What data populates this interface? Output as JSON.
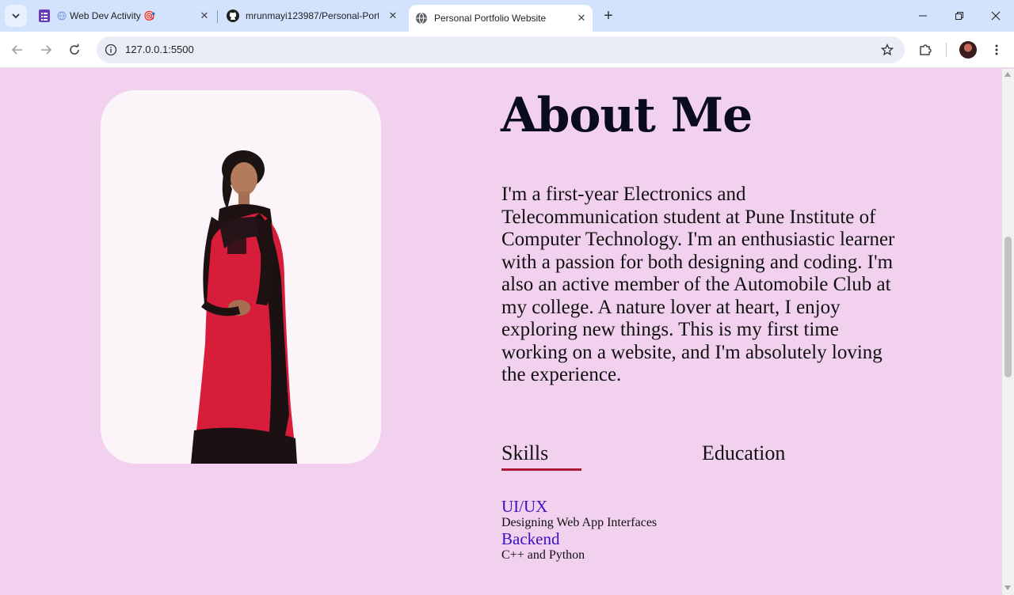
{
  "browser": {
    "tabs": [
      {
        "title": "Web Dev Activity 🎯",
        "icon": "forms-icon"
      },
      {
        "title": "mrunmayi123987/Personal-Port",
        "icon": "github-icon"
      },
      {
        "title": "Personal Portfolio Website",
        "icon": "globe-icon",
        "active": true
      }
    ],
    "url": "127.0.0.1:5500"
  },
  "about": {
    "title": "About Me",
    "text": "I'm a first-year Electronics and Telecommunication student at Pune Institute of Computer Technology. I'm an enthusiastic learner with a passion for both designing and coding. I'm also an active member of the Automobile Club at my college. A nature lover at heart, I enjoy exploring new things. This is my first time working on a website, and I'm absolutely loving the experience."
  },
  "section_tabs": [
    {
      "label": "Skills",
      "active": true
    },
    {
      "label": "Education",
      "active": false
    }
  ],
  "skills": [
    {
      "title": "UI/UX",
      "desc": "Designing Web App Interfaces"
    },
    {
      "title": "Backend",
      "desc": "C++ and Python"
    }
  ],
  "colors": {
    "page_background": "#f2d1ee",
    "skill_title": "#3a10c6",
    "active_underline": "#b0183a",
    "tabstrip": "#d3e3fd"
  }
}
